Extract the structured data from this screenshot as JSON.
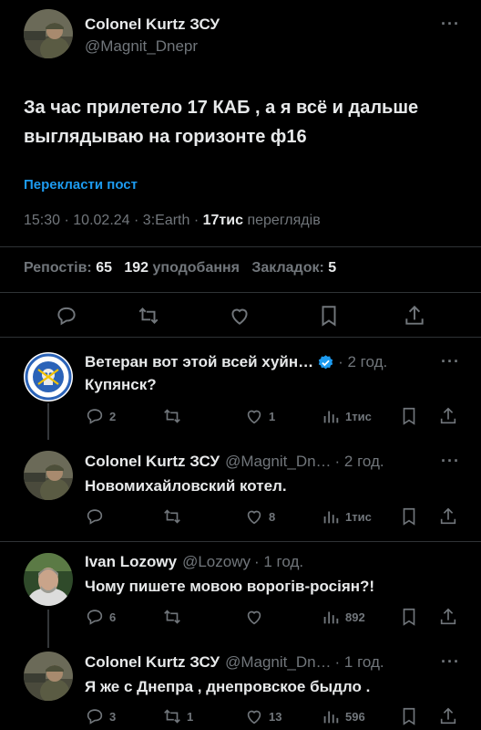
{
  "main_tweet": {
    "author_name": "Colonel Kurtz ЗСУ",
    "author_handle": "@Magnit_Dnepr",
    "more": "···",
    "text": "За час прилетело 17 КАБ , а я всё и  дальше выглядываю на горизонте ф16",
    "translate_label": "Перекласти пост",
    "time": "15:30",
    "date": "10.02.24",
    "client": "3:Earth",
    "views_count": "17тис",
    "views_label": "переглядів",
    "reposts_label": "Репостів:",
    "reposts_count": "65",
    "likes_count": "192",
    "likes_label": "уподобання",
    "bookmarks_label": "Закладок:",
    "bookmarks_count": "5"
  },
  "replies": [
    {
      "author_name": "Ветеран вот этой всей хуйн…",
      "verified": true,
      "handle": "",
      "time": "· 2 год.",
      "text": "Купянск?",
      "reply_count": "2",
      "repost_count": "",
      "like_count": "1",
      "views_count": "1тис",
      "avatar": "emblem"
    },
    {
      "author_name": "Colonel Kurtz ЗСУ",
      "verified": false,
      "handle": "@Magnit_Dn…",
      "time": "· 2 год.",
      "text": "Новомихайловский котел.",
      "reply_count": "",
      "repost_count": "",
      "like_count": "8",
      "views_count": "1тис",
      "avatar": "soldier"
    },
    {
      "author_name": "Ivan Lozowy",
      "verified": false,
      "handle": "@Lozowy",
      "time": "· 1 год.",
      "text": "Чому пишете мовою ворогів-росіян?!",
      "reply_count": "6",
      "repost_count": "",
      "like_count": "",
      "views_count": "892",
      "avatar": "person"
    },
    {
      "author_name": "Colonel Kurtz ЗСУ",
      "verified": false,
      "handle": "@Magnit_Dn…",
      "time": "· 1 год.",
      "text": "Я же с Днепра , днепровское быдло .",
      "reply_count": "3",
      "repost_count": "1",
      "like_count": "13",
      "views_count": "596",
      "avatar": "soldier"
    }
  ],
  "colors": {
    "background": "#000000",
    "text": "#e7e9ea",
    "muted": "#71767b",
    "accent": "#1d9bf0",
    "divider": "#2f3336"
  },
  "icons": [
    "reply-icon",
    "repost-icon",
    "like-icon",
    "bookmark-icon",
    "share-icon",
    "views-icon",
    "verified-icon",
    "more-icon"
  ]
}
